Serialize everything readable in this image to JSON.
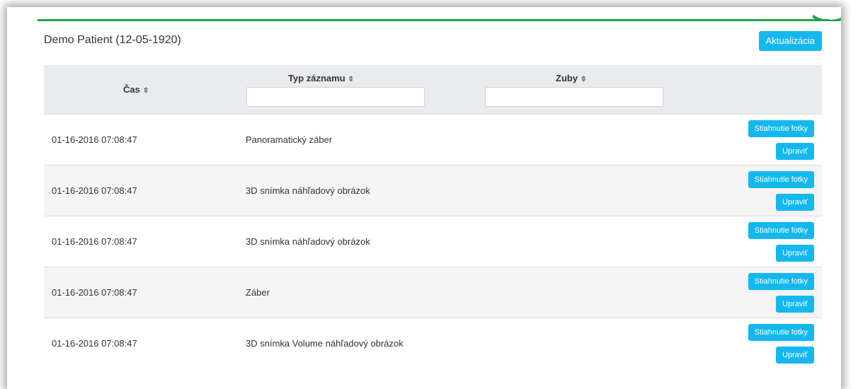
{
  "header": {
    "patient": "Demo Patient (12-05-1920)",
    "update_label": "Aktualizácia"
  },
  "columns": [
    {
      "label": "Čas",
      "sort_icon": "sort-icon"
    },
    {
      "label": "Typ záznamu",
      "sort_icon": "sort-icon"
    },
    {
      "label": "Zuby",
      "sort_icon": "sort-icon"
    }
  ],
  "filters": {
    "type_value": "",
    "teeth_value": ""
  },
  "sort_glyph": "⇳",
  "rows": [
    {
      "time": "01-16-2016 07:08:47",
      "type": "Panoramatický záber",
      "teeth": ""
    },
    {
      "time": "01-16-2016 07:08:47",
      "type": "3D snímka náhľadový obrázok",
      "teeth": ""
    },
    {
      "time": "01-16-2016 07:08:47",
      "type": "3D snímka náhľadový obrázok",
      "teeth": ""
    },
    {
      "time": "01-16-2016 07:08:47",
      "type": "Záber",
      "teeth": ""
    },
    {
      "time": "01-16-2016 07:08:47",
      "type": "3D snímka Volume náhľadový obrázok",
      "teeth": ""
    }
  ],
  "row_actions": {
    "download_label": "Stiahnutie fotky",
    "edit_label": "Upraviť"
  },
  "colors": {
    "accent_green": "#22a34a",
    "button_blue": "#14b8ee",
    "header_bg": "#e9ebee"
  }
}
